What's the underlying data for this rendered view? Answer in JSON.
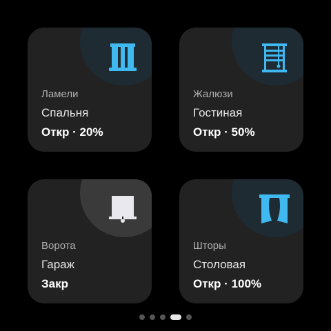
{
  "colors": {
    "accent_open": "#40b8f0",
    "icon_closed": "#e8e8ee",
    "tile_bg": "#222222",
    "blob_open": "#1e2b33",
    "blob_closed": "#3a3a3a"
  },
  "tiles": [
    {
      "type": "Ламели",
      "room": "Спальня",
      "state": "Откр · 20%",
      "icon": "door-icon",
      "open_percent": 20
    },
    {
      "type": "Жалюзи",
      "room": "Гостиная",
      "state": "Откр · 50%",
      "icon": "blinds-icon",
      "open_percent": 50
    },
    {
      "type": "Ворота",
      "room": "Гараж",
      "state": "Закр",
      "icon": "garage-gate-icon",
      "open_percent": 0
    },
    {
      "type": "Шторы",
      "room": "Столовая",
      "state": "Откр · 100%",
      "icon": "curtains-icon",
      "open_percent": 100
    }
  ],
  "pager": {
    "count": 5,
    "active_index": 3
  }
}
